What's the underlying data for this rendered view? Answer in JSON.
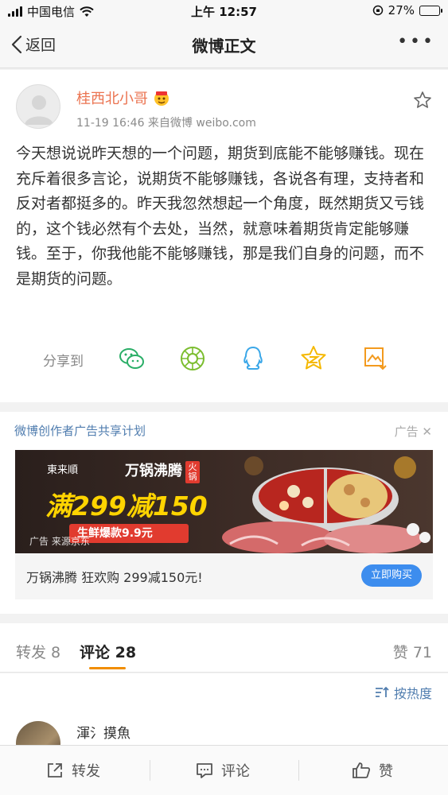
{
  "status_bar": {
    "carrier": "中国电信",
    "time": "上午 12:57",
    "battery_percent_text": "27%",
    "battery_level": 0.27
  },
  "nav": {
    "back_label": "返回",
    "title": "微博正文",
    "more_label": "•••"
  },
  "post": {
    "username": "桂西北小哥",
    "meta": "11-19 16:46  来自微博 weibo.com",
    "content": "今天想说说昨天想的一个问题，期货到底能不能够赚钱。现在充斥着很多言论，说期货不能够赚钱，各说各有理，支持者和反对者都挺多的。昨天我忽然想起一个角度，既然期货又亏钱的，这个钱必然有个去处，当然，就意味着期货肯定能够赚钱。至于，你我他能不能够赚钱，那是我们自身的问题，而不是期货的问题。",
    "share_label": "分享到",
    "share_targets": [
      "wechat-icon",
      "moments-icon",
      "qq-icon",
      "qzone-icon",
      "save-image-icon"
    ]
  },
  "ad": {
    "program_title": "微博创作者广告共享计划",
    "ad_tag": "广告",
    "banner": {
      "brand": "東来順",
      "headline": "万锅沸腾",
      "badge": "火锅",
      "main": "满299减150",
      "sub": "生鲜爆款9.9元",
      "source": "广告 来源京东"
    },
    "description": "万锅沸腾 狂欢购 299减150元!",
    "cta": "立即购买"
  },
  "tabs": {
    "repost": "转发 8",
    "comment": "评论 28",
    "like": "赞 71"
  },
  "comments": {
    "sort_label": "按热度",
    "first_user": "渾氵摸魚"
  },
  "toolbar": {
    "repost": "转发",
    "comment": "评论",
    "like": "赞"
  },
  "colors": {
    "username": "#eb7350",
    "link": "#507daf",
    "accent_tab": "#f18d00",
    "cta": "#3d8dee"
  }
}
